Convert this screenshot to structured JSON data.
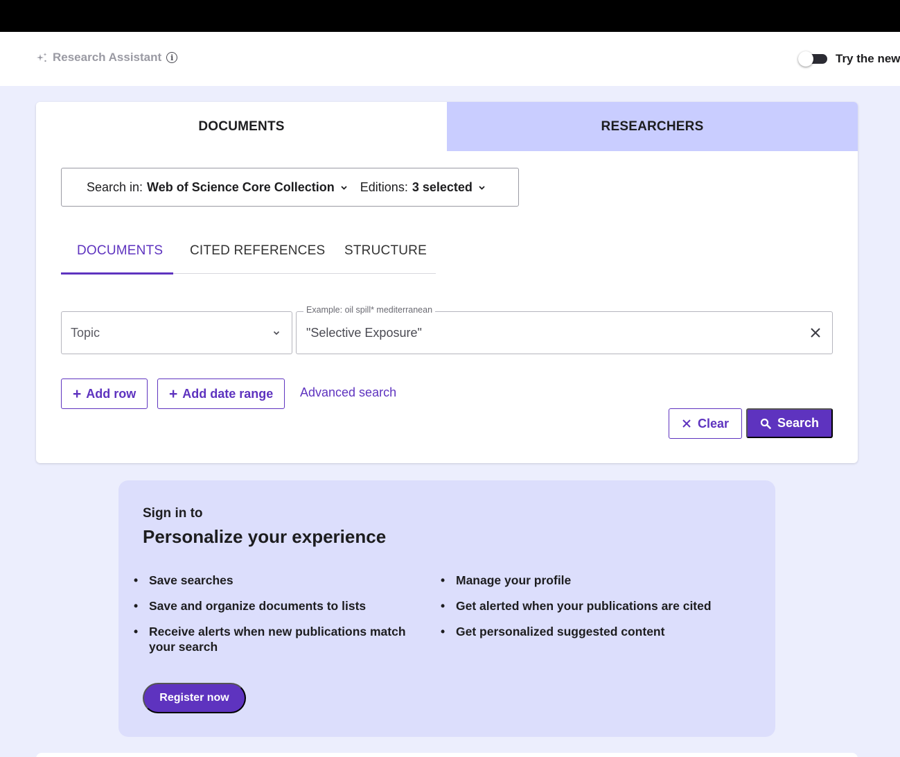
{
  "assistant": {
    "label": "Research Assistant",
    "info_glyph": "i"
  },
  "toggle": {
    "label": "Try the new",
    "state": "off"
  },
  "main_tabs": [
    {
      "label": "DOCUMENTS",
      "active": true
    },
    {
      "label": "RESEARCHERS",
      "active": false
    }
  ],
  "search_in": {
    "prefix": "Search in:",
    "collection": "Web of Science Core Collection",
    "editions_prefix": "Editions:",
    "editions_value": "3 selected"
  },
  "sub_tabs": [
    {
      "label": "DOCUMENTS",
      "active": true
    },
    {
      "label": "CITED REFERENCES",
      "active": false
    },
    {
      "label": "STRUCTURE",
      "active": false
    }
  ],
  "query": {
    "field": "Topic",
    "placeholder_label": "Example: oil spill* mediterranean",
    "value": "\"Selective Exposure\""
  },
  "actions": {
    "add_row": "Add row",
    "add_date_range": "Add date range",
    "advanced_search": "Advanced search",
    "clear": "Clear",
    "search": "Search",
    "plus_glyph": "+"
  },
  "promo": {
    "subtitle": "Sign in to",
    "title": "Personalize your experience",
    "left_items": [
      "Save searches",
      "Save and organize documents to lists",
      "Receive alerts when new publications match your search"
    ],
    "right_items": [
      "Manage your profile",
      "Get alerted when your publications are cited",
      "Get personalized suggested content"
    ],
    "cta": "Register now"
  },
  "colors": {
    "accent": "#5e33bf",
    "tab_inactive": "#c9cdff",
    "page_bg": "#eceefd",
    "promo_bg": "#dcdefc"
  }
}
